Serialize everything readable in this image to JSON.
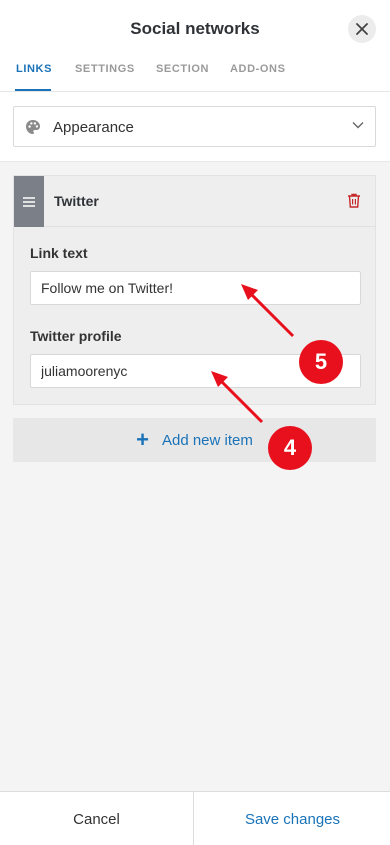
{
  "header": {
    "title": "Social networks",
    "close_icon": "close-icon"
  },
  "tabs": [
    {
      "label": "LINKS",
      "active": true
    },
    {
      "label": "SETTINGS",
      "active": false
    },
    {
      "label": "SECTION",
      "active": false
    },
    {
      "label": "ADD-ONS",
      "active": false
    }
  ],
  "appearance": {
    "label": "Appearance",
    "icon": "palette-icon",
    "chevron": "chevron-down-icon"
  },
  "item": {
    "name": "Twitter",
    "link_text_label": "Link text",
    "link_text_value": "Follow me on Twitter!",
    "profile_label": "Twitter profile",
    "profile_value": "juliamoorenyc"
  },
  "add_item": {
    "label": "Add new item"
  },
  "annotations": {
    "badge_a": "5",
    "badge_b": "4",
    "color": "#e8101c"
  },
  "footer": {
    "cancel": "Cancel",
    "save": "Save changes"
  },
  "colors": {
    "accent": "#1a73b8",
    "danger": "#c62828",
    "handle": "#7b8088"
  }
}
